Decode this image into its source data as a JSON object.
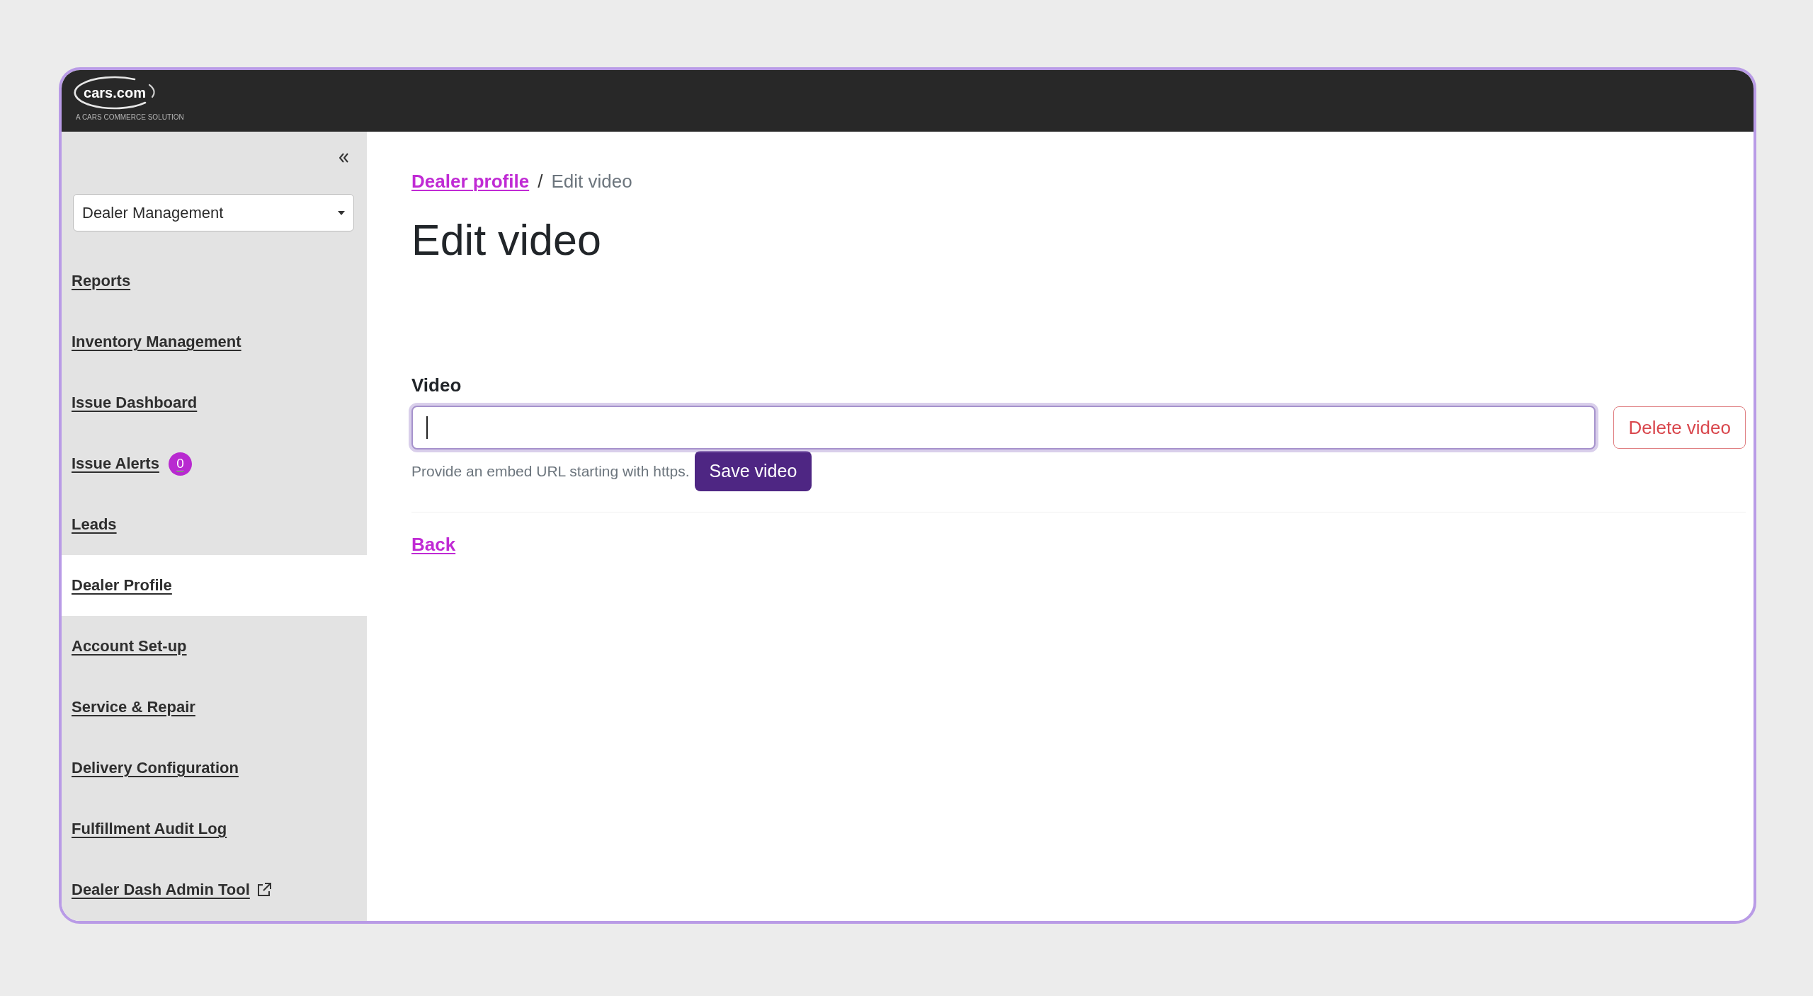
{
  "header": {
    "logo": {
      "wordmark": "cars.com",
      "tagline": "A CARS COMMERCE SOLUTION"
    }
  },
  "sidebar": {
    "dropdown": {
      "value": "Dealer Management"
    },
    "items": [
      {
        "label": "Reports",
        "selected": false,
        "external": false
      },
      {
        "label": "Inventory Management",
        "selected": false,
        "external": false
      },
      {
        "label": "Issue Dashboard",
        "selected": false,
        "external": false
      },
      {
        "label": "Issue Alerts",
        "selected": false,
        "external": false,
        "badge": "0"
      },
      {
        "label": "Leads",
        "selected": false,
        "external": false
      },
      {
        "label": "Dealer Profile",
        "selected": true,
        "external": false
      },
      {
        "label": "Account Set-up",
        "selected": false,
        "external": false
      },
      {
        "label": "Service & Repair",
        "selected": false,
        "external": false
      },
      {
        "label": "Delivery Configuration",
        "selected": false,
        "external": false
      },
      {
        "label": "Fulfillment Audit Log",
        "selected": false,
        "external": false
      },
      {
        "label": "Dealer Dash Admin Tool",
        "selected": false,
        "external": true
      }
    ]
  },
  "breadcrumb": {
    "separator": "/",
    "items": [
      {
        "label": "Dealer profile",
        "kind": "link"
      },
      {
        "label": "Edit video",
        "kind": "current"
      }
    ]
  },
  "page_title": "Edit video",
  "video_field": {
    "label": "Video",
    "focused": true,
    "help_text": "Provide an embed URL starting with https.",
    "save_button": "Save video",
    "delete_button": "Delete video"
  },
  "back_link": "Back"
}
